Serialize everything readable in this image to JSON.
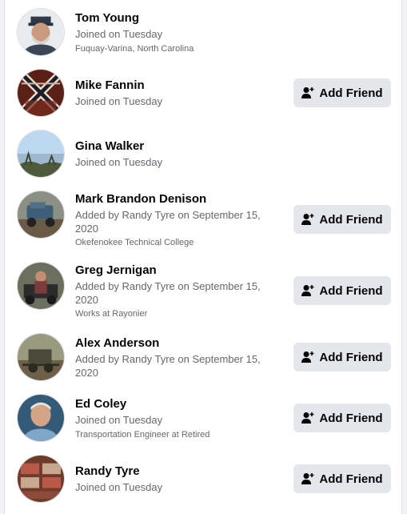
{
  "add_friend_label": "Add Friend",
  "people": [
    {
      "name": "Tom Young",
      "status": "Joined on Tuesday",
      "detail": "Fuquay-Varina, North Carolina"
    },
    {
      "name": "Mike Fannin",
      "status": "Joined on Tuesday"
    },
    {
      "name": "Gina Walker",
      "status": "Joined on Tuesday"
    },
    {
      "name": "Mark Brandon Denison",
      "status": "Added by Randy Tyre on September 15, 2020",
      "detail": "Okefenokee Technical College"
    },
    {
      "name": "Greg Jernigan",
      "status": "Added by Randy Tyre on September 15, 2020",
      "detail": "Works at Rayonier"
    },
    {
      "name": "Alex Anderson",
      "status": "Added by Randy Tyre on September 15, 2020"
    },
    {
      "name": "Ed Coley",
      "status": "Joined on Tuesday",
      "detail": "Transportation Engineer at Retired"
    },
    {
      "name": "Randy Tyre",
      "status": "Joined on Tuesday"
    }
  ],
  "colors": {
    "button_bg": "#e4e6eb",
    "secondary_text": "#65676b",
    "primary_text": "#050505"
  }
}
